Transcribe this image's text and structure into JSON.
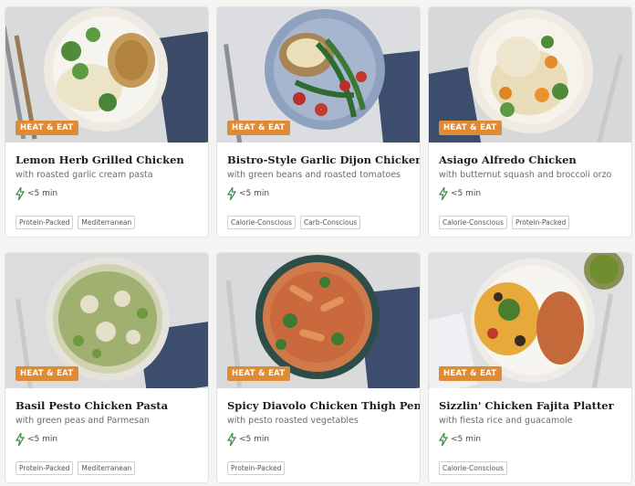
{
  "badge_label": "HEAT & EAT",
  "colors": {
    "badge": "#e08a34",
    "bolt": "#3e8a4b"
  },
  "cards": [
    {
      "title": "Lemon Herb Grilled Chicken",
      "subtitle": "with roasted garlic cream pasta",
      "time": "<5 min",
      "tags": [
        "Protein-Packed",
        "Mediterranean"
      ]
    },
    {
      "title": "Bistro-Style Garlic Dijon Chicken",
      "subtitle": "with green beans and roasted tomatoes",
      "time": "<5 min",
      "tags": [
        "Calorie-Conscious",
        "Carb-Conscious"
      ]
    },
    {
      "title": "Asiago Alfredo Chicken",
      "subtitle": "with butternut squash and broccoli orzo",
      "time": "<5 min",
      "tags": [
        "Calorie-Conscious",
        "Protein-Packed"
      ]
    },
    {
      "title": "Basil Pesto Chicken Pasta",
      "subtitle": "with green peas and Parmesan",
      "time": "<5 min",
      "tags": [
        "Protein-Packed",
        "Mediterranean"
      ]
    },
    {
      "title": "Spicy Diavolo Chicken Thigh Penne",
      "subtitle": "with pesto roasted vegetables",
      "time": "<5 min",
      "tags": [
        "Protein-Packed"
      ]
    },
    {
      "title": "Sizzlin' Chicken Fajita Platter",
      "subtitle": "with fiesta rice and guacamole",
      "time": "<5 min",
      "tags": [
        "Calorie-Conscious"
      ]
    }
  ]
}
